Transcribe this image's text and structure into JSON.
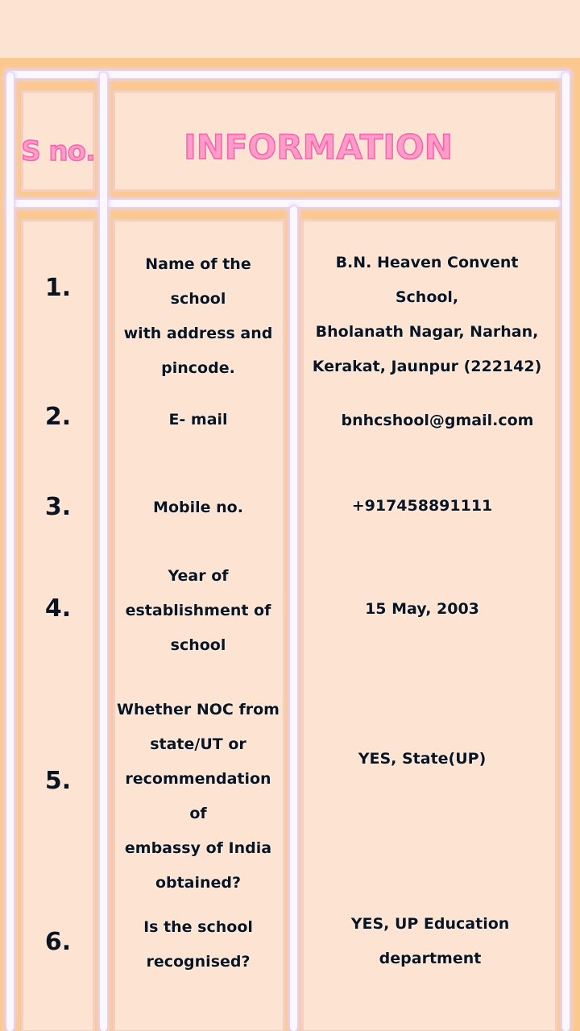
{
  "header": {
    "sno": "S no.",
    "information": "INFORMATION"
  },
  "rows": [
    {
      "num": "1.",
      "label": "Name of the school\nwith address and\npincode.",
      "value": "B.N. Heaven Convent School,\nBholanath Nagar, Narhan,\nKerakat, Jaunpur (222142)"
    },
    {
      "num": "2.",
      "label": "E- mail",
      "value": "bnhcshool@gmail.com"
    },
    {
      "num": "3.",
      "label": "Mobile no.",
      "value": "+917458891111"
    },
    {
      "num": "4.",
      "label": "Year of\nestablishment of\nschool",
      "value": "15 May, 2003"
    },
    {
      "num": "5.",
      "label": "Whether NOC from\nstate/UT or\nrecommendation of\nembassy of India\nobtained?",
      "value": "YES, State(UP)"
    },
    {
      "num": "6.",
      "label": "Is the school\nrecognised?",
      "value": "YES, UP Education\ndepartment"
    }
  ]
}
